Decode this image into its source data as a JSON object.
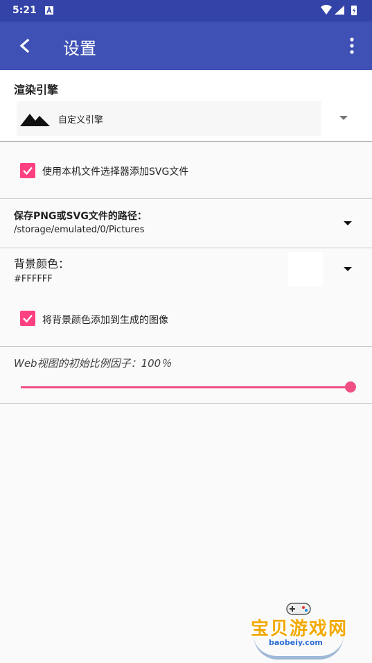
{
  "status_bar": {
    "time": "5:21"
  },
  "app_bar": {
    "title": "设置"
  },
  "render_engine": {
    "title": "渲染引擎",
    "value": "自定义引擎"
  },
  "use_file_chooser": {
    "label": "使用本机文件选择器添加SVG文件",
    "checked": true
  },
  "save_path": {
    "title": "保存PNG或SVG文件的路径：",
    "value": "/storage/emulated/0/Pictures"
  },
  "background_color": {
    "title": "背景颜色：",
    "value": "#FFFFFF"
  },
  "add_background": {
    "label": "将背景颜色添加到生成的图像",
    "checked": true
  },
  "webview_scale": {
    "label": "Web视图的初始比例因子：100％",
    "value_percent": 100
  },
  "watermark": {
    "text": "宝贝游戏网",
    "domain": "baobeiy.com"
  },
  "colors": {
    "primary": "#3f51b5",
    "primary_dark": "#3343a8",
    "accent": "#ff4081"
  }
}
